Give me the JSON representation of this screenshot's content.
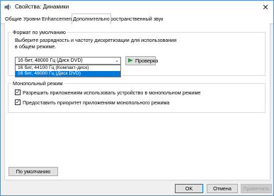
{
  "window": {
    "title": "Свойства: Динамики",
    "close_glyph": "✕"
  },
  "tabs": [
    {
      "label": "Общие",
      "active": false
    },
    {
      "label": "Уровни",
      "active": false
    },
    {
      "label": "Enhancements",
      "active": false
    },
    {
      "label": "Дополнительно",
      "active": true
    },
    {
      "label": "Пространственный звук",
      "active": false
    }
  ],
  "default_format": {
    "group_label": "Формат по умолчанию",
    "description_line1": "Выберите разрядность и частоту дискретизации для использования",
    "description_line2": "в общем режиме.",
    "selected": "16 бит, 48000 Гц (Диск DVD)",
    "options": [
      "16 бит, 44100 Гц (Компакт-диск)",
      "16 бит, 48000 Гц (Диск DVD)"
    ],
    "highlighted_option_index": 1,
    "test_button": "Проверка"
  },
  "exclusive_mode": {
    "group_label": "Монопольный режим",
    "allow_exclusive": {
      "label": "Разрешить приложениям использовать устройство в монопольном режиме",
      "checked": true
    },
    "give_priority": {
      "label": "Предоставить приоритет приложениям монопольного режима",
      "checked": true
    }
  },
  "restore_defaults_button": "По умолчанию",
  "footer": {
    "ok": "OK",
    "cancel": "Отмена",
    "apply": "Применить"
  },
  "colors": {
    "accent": "#0078d7",
    "play_icon": "#2e9a3e",
    "window_border": "#5a8fc9"
  },
  "icons": {
    "app": "speaker-icon",
    "test": "play-icon",
    "dropdown": "chevron-down-icon",
    "check": "checkmark-icon"
  }
}
